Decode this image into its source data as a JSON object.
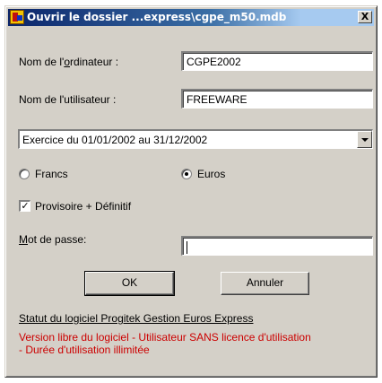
{
  "window": {
    "title": "Ouvrir le dossier ...express\\cgpe_m50.mdb",
    "close_label": "X"
  },
  "computer": {
    "label_prefix": "Nom de l'",
    "label_accel": "o",
    "label_suffix": "rdinateur :",
    "value": "CGPE2002"
  },
  "user": {
    "label": "Nom de l'utilisateur :",
    "value": "FREEWARE"
  },
  "exercise": {
    "selected": "Exercice du 01/01/2002 au 31/12/2002"
  },
  "currency": {
    "francs_label": "Francs",
    "euros_label": "Euros",
    "selected": "Euros"
  },
  "provisional": {
    "label": "Provisoire + Définitif",
    "checked": true,
    "check_glyph": "✓"
  },
  "password": {
    "label_accel": "M",
    "label_rest": "ot de passe:",
    "value": ""
  },
  "buttons": {
    "ok_label": "OK",
    "cancel_label": "Annuler"
  },
  "info": {
    "status_link": "Statut du logiciel Progitek Gestion Euros Express",
    "license_text": "Version libre du logiciel - Utilisateur SANS licence d'utilisation - Durée d'utilisation illimitée"
  },
  "colors": {
    "title_bar_start": "#0a246a",
    "title_bar_end": "#a6caf0",
    "dialog_bg": "#d4d0c8",
    "license_text": "#cc0000"
  },
  "icons": {
    "app": "progitek-app-icon",
    "close": "close-icon",
    "dropdown": "chevron-down-icon"
  }
}
